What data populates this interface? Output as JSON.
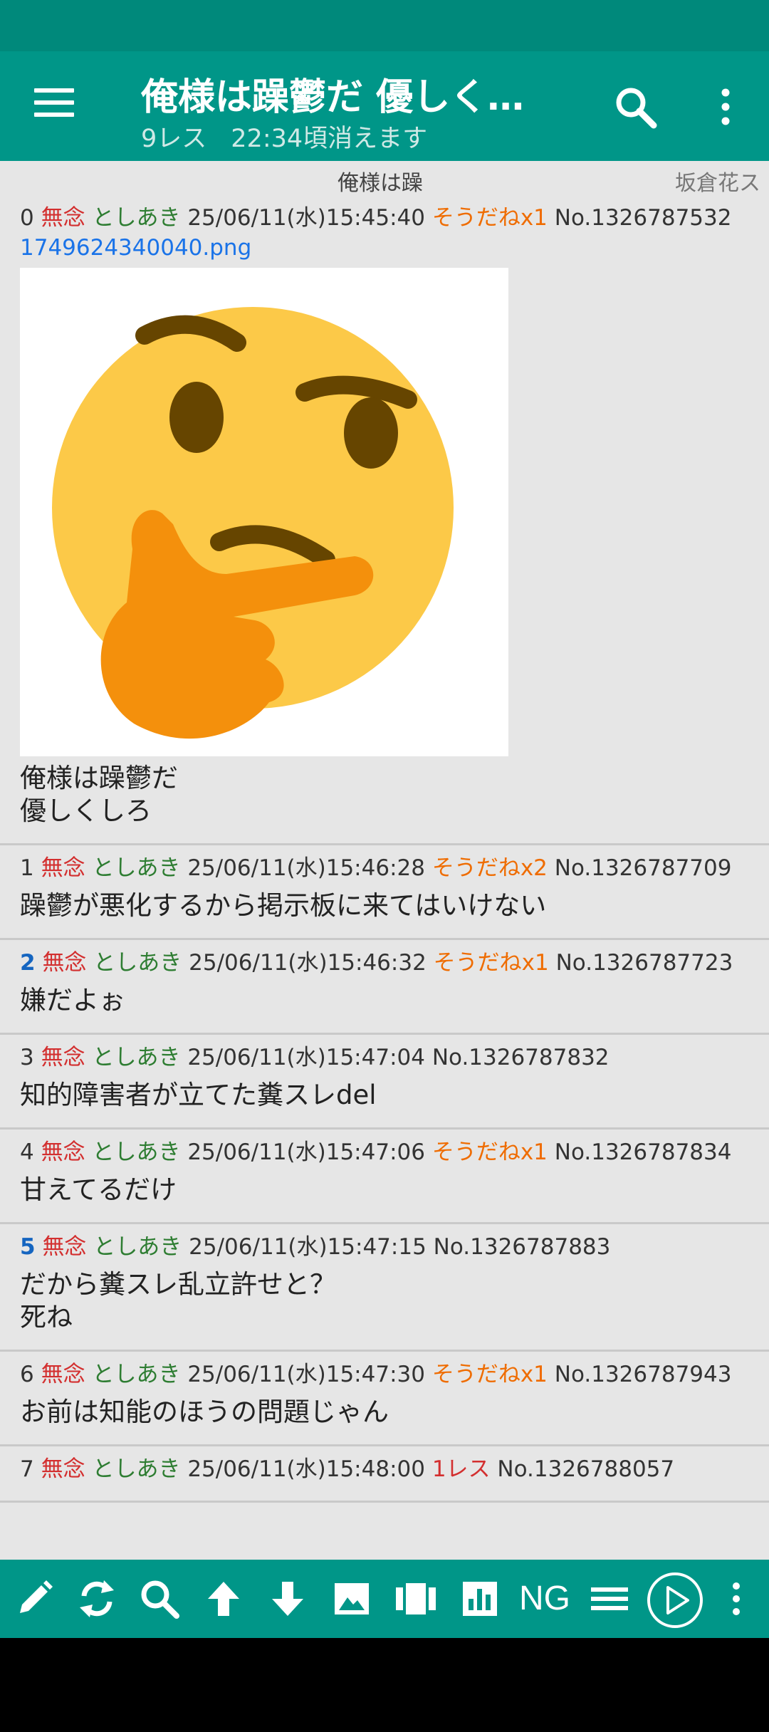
{
  "header": {
    "title": "俺様は躁鬱だ 優しく…",
    "res_count": "9レス",
    "expire": "22:34頃消えます"
  },
  "strip": {
    "center": "俺様は躁",
    "right": "坂倉花ス"
  },
  "posts": [
    {
      "num": "0",
      "mu": "無念",
      "name": "としあき",
      "date": "25/06/11(水)15:45:40",
      "sodane": "そうだねx1",
      "no": "No.1326787532",
      "file": "1749624340040.png",
      "body": "俺様は躁鬱だ\n優しくしろ"
    },
    {
      "num": "1",
      "mu": "無念",
      "name": "としあき",
      "date": "25/06/11(水)15:46:28",
      "sodane": "そうだねx2",
      "no": "No.1326787709",
      "body": "躁鬱が悪化するから掲示板に来てはいけない"
    },
    {
      "num": "2",
      "mu": "無念",
      "name": "としあき",
      "date": "25/06/11(水)15:46:32",
      "sodane": "そうだねx1",
      "no": "No.1326787723",
      "body": "嫌だよぉ"
    },
    {
      "num": "3",
      "mu": "無念",
      "name": "としあき",
      "date": "25/06/11(水)15:47:04",
      "no": "No.1326787832",
      "body": "知的障害者が立てた糞スレdel"
    },
    {
      "num": "4",
      "mu": "無念",
      "name": "としあき",
      "date": "25/06/11(水)15:47:06",
      "sodane": "そうだねx1",
      "no": "No.1326787834",
      "body": "甘えてるだけ"
    },
    {
      "num": "5",
      "mu": "無念",
      "name": "としあき",
      "date": "25/06/11(水)15:47:15",
      "no": "No.1326787883",
      "body": "だから糞スレ乱立許せと？\n死ね"
    },
    {
      "num": "6",
      "mu": "無念",
      "name": "としあき",
      "date": "25/06/11(水)15:47:30",
      "sodane": "そうだねx1",
      "no": "No.1326787943",
      "body": "お前は知能のほうの問題じゃん"
    },
    {
      "num": "7",
      "mu": "無念",
      "name": "としあき",
      "date": "25/06/11(水)15:48:00",
      "replies": "1レス",
      "no": "No.1326788057"
    }
  ],
  "toolbar": {
    "ng_label": "NG"
  },
  "colors": {
    "accent": "#009688",
    "mu": "#d32f2f",
    "name": "#2e7d32",
    "sodane": "#ef6c00",
    "link": "#1a73e8"
  },
  "icons": [
    "menu-icon",
    "search-icon",
    "more-vert-icon",
    "pencil-icon",
    "refresh-icon",
    "search-icon",
    "arrow-up-icon",
    "arrow-down-icon",
    "image-icon",
    "catalog-icon",
    "chart-icon",
    "list-icon",
    "play-icon",
    "more-vert-icon"
  ]
}
